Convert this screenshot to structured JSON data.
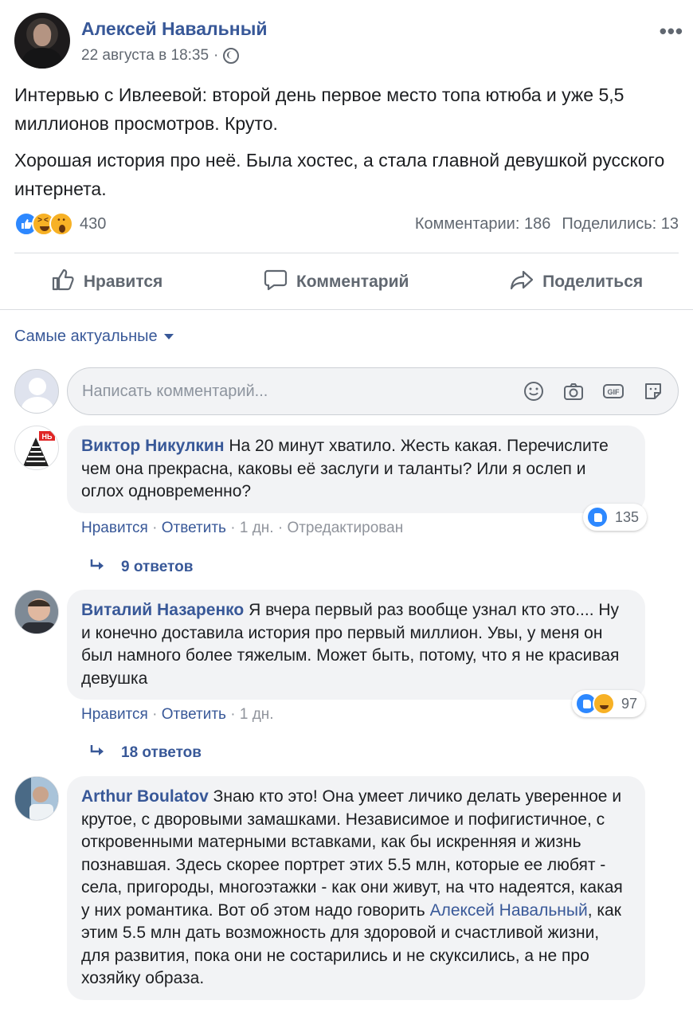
{
  "post": {
    "author": "Алексей Навальный",
    "date": "22 августа в 18:35",
    "separator": "·",
    "paragraphs": [
      "Интервью с Ивлеевой: второй день первое место топа ютюба и уже 5,5 миллионов просмотров. Круто.",
      "Хорошая история про неё. Была хостес, а стала главной девушкой русского интернета."
    ],
    "reactions_count": "430",
    "comments_count": "Комментарии: 186",
    "shares_count": "Поделились: 13"
  },
  "actions": {
    "like": "Нравится",
    "comment": "Комментарий",
    "share": "Поделиться"
  },
  "sort": {
    "label": "Самые актуальные"
  },
  "composer": {
    "placeholder": "Написать комментарий..."
  },
  "comments": [
    {
      "author": "Виктор Никулкин",
      "text": "На 20 минут хватило. Жесть какая. Перечислите чем она прекрасна, каковы её заслуги и таланты? Или я ослеп и оглох одновременно?",
      "like": "Нравится",
      "reply": "Ответить",
      "time": "1 дн.",
      "edited": "Отредактирован",
      "reactions": "135",
      "replies": "9 ответов"
    },
    {
      "author": "Виталий Назаренко",
      "text": "Я вчера первый раз вообще узнал кто это.... Ну и конечно доставила история про первый миллион. Увы, у меня он был намного более тяжелым. Может быть, потому, что я не красивая девушка",
      "like": "Нравится",
      "reply": "Ответить",
      "time": "1 дн.",
      "reactions": "97",
      "replies": "18 ответов"
    },
    {
      "author": "Arthur Boulatov",
      "text_before": "Знаю кто это! Она умеет личико делать уверенное и крутое, с дворовыми замашками. Независимое и пофигистичное, с откровенными матерными вставками, как бы искренняя и жизнь познавшая. Здесь скорее портрет этих 5.5 млн, которые ее любят - села, пригороды, многоэтажки - как они живут, на что надеятся, какая у них романтика. Вот об этом надо говорить",
      "mention": "Алексей Навальный",
      "text_after": ", как этим 5.5 млн дать возможность для здоровой и счастливой жизни, для развития, пока они не состарились и не скуксились, а не про хозяйку образа."
    }
  ],
  "colors": {
    "link": "#385898",
    "meta": "#606770",
    "bubble": "#f2f3f5",
    "like_blue": "#2d88ff",
    "emoji_yellow": "#f7b125"
  },
  "icons": [
    "globe-icon",
    "more-icon",
    "like-icon",
    "comment-icon",
    "share-icon",
    "caret-down-icon",
    "emoji-icon",
    "camera-icon",
    "gif-icon",
    "sticker-icon",
    "reply-arrow-icon"
  ]
}
